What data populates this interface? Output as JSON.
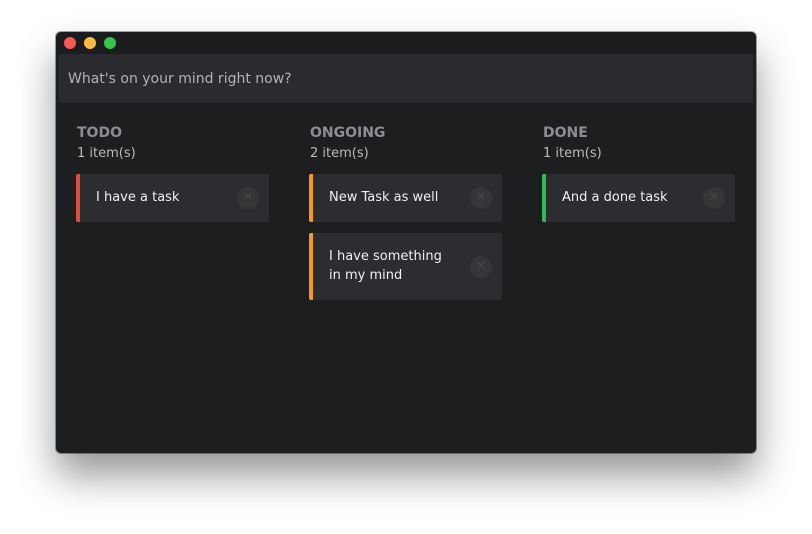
{
  "input": {
    "placeholder": "What's on your mind right now?"
  },
  "columns": [
    {
      "title": "TODO",
      "count": "1 item(s)",
      "accent": "#e34a3f",
      "items": [
        "I have a task"
      ]
    },
    {
      "title": "ONGOING",
      "count": "2 item(s)",
      "accent": "#f59a21",
      "items": [
        "New Task as well",
        "I have something in my mind"
      ]
    },
    {
      "title": "DONE",
      "count": "1 item(s)",
      "accent": "#2dbd4e",
      "items": [
        "And a done task"
      ]
    }
  ],
  "icons": {
    "remove": "close-icon",
    "remove_glyph": "✕"
  },
  "colors": {
    "window_bg": "#1d1e20",
    "card_bg": "#2c2d30",
    "input_bg": "#2a2b2e"
  }
}
